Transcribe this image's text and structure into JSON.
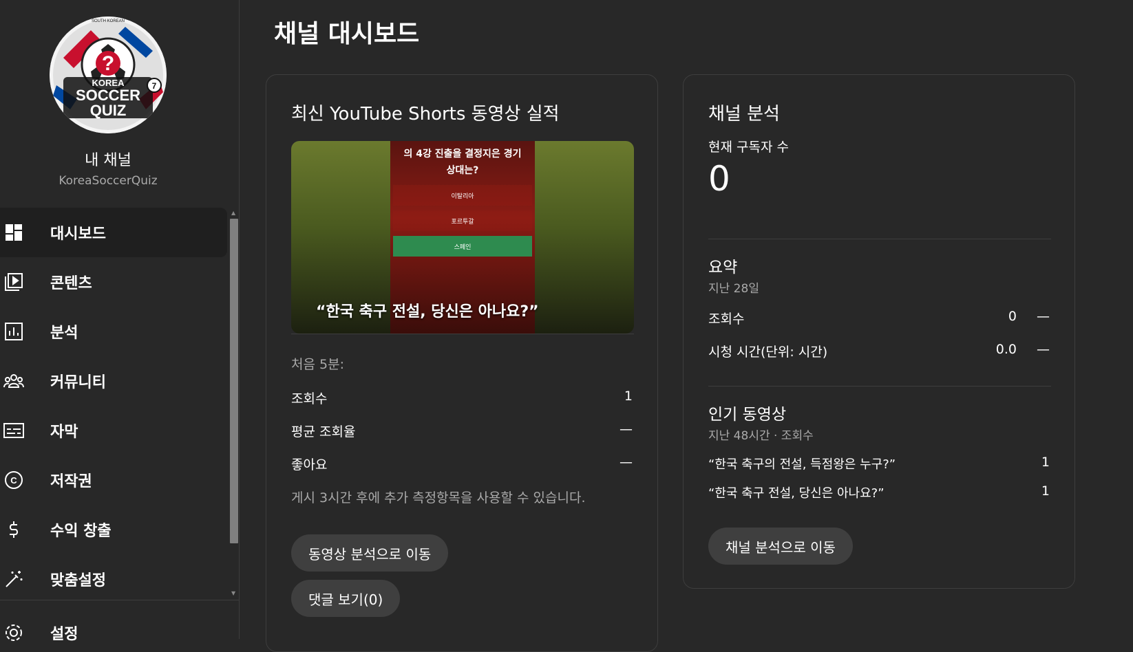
{
  "sidebar": {
    "channel_label": "내 채널",
    "channel_handle": "KoreaSoccerQuiz",
    "items": [
      {
        "label": "대시보드",
        "icon": "dashboard-icon"
      },
      {
        "label": "콘텐츠",
        "icon": "content-icon"
      },
      {
        "label": "분석",
        "icon": "analytics-icon"
      },
      {
        "label": "커뮤니티",
        "icon": "community-icon"
      },
      {
        "label": "자막",
        "icon": "subtitles-icon"
      },
      {
        "label": "저작권",
        "icon": "copyright-icon"
      },
      {
        "label": "수익 창출",
        "icon": "monetization-icon"
      },
      {
        "label": "맞춤설정",
        "icon": "customization-icon"
      }
    ],
    "settings_label": "설정",
    "active_index": 0
  },
  "page": {
    "title": "채널 대시보드"
  },
  "latest_video": {
    "title": "최신 YouTube Shorts 동영상 실적",
    "thumbnail": {
      "question_line1": "의 4강 진출을 결정지은 경기",
      "question_line2": "상대는?",
      "options": [
        "이탈리아",
        "포르투갈",
        "스페인"
      ],
      "caption": "“한국 축구 전설, 당신은 아나요?”"
    },
    "period_label": "처음 5분:",
    "stats": [
      {
        "label": "조회수",
        "value": "1"
      },
      {
        "label": "평균 조회율",
        "value": "—"
      },
      {
        "label": "좋아요",
        "value": "—"
      }
    ],
    "note": "게시 3시간 후에 추가 측정항목을 사용할 수 있습니다.",
    "analytics_button": "동영상 분석으로 이동",
    "comments_button": "댓글 보기(0)"
  },
  "channel_analytics": {
    "title": "채널 분석",
    "subscribers_label": "현재 구독자 수",
    "subscribers_value": "0",
    "summary_title": "요약",
    "summary_period": "지난 28일",
    "summary_rows": [
      {
        "label": "조회수",
        "value": "0",
        "trend": "—"
      },
      {
        "label": "시청 시간(단위: 시간)",
        "value": "0.0",
        "trend": "—"
      }
    ],
    "popular_title": "인기 동영상",
    "popular_period": "지난 48시간 · 조회수",
    "popular_videos": [
      {
        "title": "“한국 축구의 전설, 득점왕은 누구?”",
        "views": "1"
      },
      {
        "title": "“한국 축구 전설, 당신은 아나요?”",
        "views": "1"
      }
    ],
    "button": "채널 분석으로 이동"
  },
  "logo": {
    "top_text": "SOUTH KOREAN",
    "line1": "KOREA",
    "line2": "SOCCER",
    "line3": "QUIZ",
    "badge": "7"
  },
  "colors": {
    "background": "#282828",
    "card_border": "#3e3e3e",
    "button": "#3f3f3f",
    "muted_text": "#aaaaaa"
  }
}
